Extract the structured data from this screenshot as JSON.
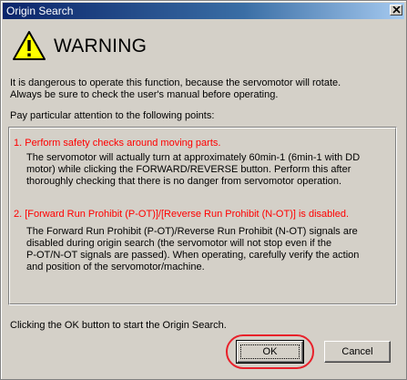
{
  "window": {
    "title": "Origin Search",
    "close_icon": "close-icon"
  },
  "warning": {
    "icon": "warning-triangle-icon",
    "title": "WARNING",
    "intro_lines": [
      "It is dangerous to operate this function, because the servomotor will rotate.",
      "Always be sure to check the user's manual before operating."
    ],
    "points_label": "Pay particular attention to the following points:"
  },
  "points": [
    {
      "title": "1. Perform safety checks around moving parts.",
      "lines": [
        "The servomotor will actually turn at approximately 60min-1 (6min-1 with DD",
        "motor) while clicking the FORWARD/REVERSE button. Perform this after",
        "thoroughly checking that there is no danger from servomotor operation."
      ]
    },
    {
      "title": "2. [Forward Run Prohibit (P-OT)]/[Reverse Run Prohibit (N-OT)] is disabled.",
      "lines": [
        "The Forward Run Prohibit (P-OT)/Reverse Run Prohibit (N-OT) signals are",
        "disabled during origin search (the servomotor will not stop even if the",
        "P-OT/N-OT signals are passed). When operating, carefully verify the action",
        "and position of the servomotor/machine."
      ]
    }
  ],
  "footer": {
    "instruction": "Clicking the OK button to start the Origin Search.",
    "ok_label": "OK",
    "cancel_label": "Cancel"
  },
  "colors": {
    "accent_red": "#ff0000",
    "highlight_ring": "#e8202a",
    "title_bar": "#0a246a",
    "warning_yellow": "#ffff00"
  }
}
